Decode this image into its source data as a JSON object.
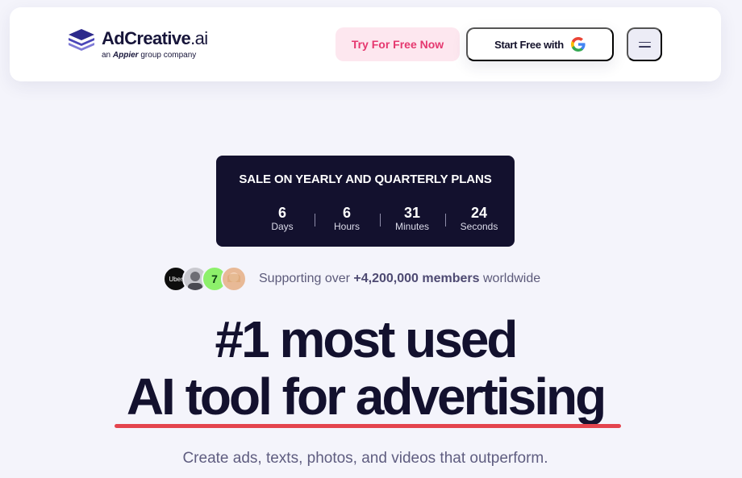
{
  "nav": {
    "logo_word": "AdCreative",
    "logo_word_suffix": ".ai",
    "logo_sub_prefix": "an",
    "logo_sub_brand": "Appier",
    "logo_sub_suffix": "group company",
    "try_button": "Try For Free Now",
    "google_button": "Start Free with",
    "google_icon": "google-g-icon",
    "menu_icon": "hamburger-menu-icon"
  },
  "sale": {
    "title": "SALE ON YEARLY AND QUARTERLY PLANS",
    "countdown": [
      {
        "value": "6",
        "label": "Days"
      },
      {
        "value": "6",
        "label": "Hours"
      },
      {
        "value": "31",
        "label": "Minutes"
      },
      {
        "value": "24",
        "label": "Seconds"
      }
    ]
  },
  "social_proof": {
    "avatars": [
      "Uber",
      "person-portrait",
      "7",
      "person-portrait"
    ],
    "text_prefix": "Supporting over",
    "count": "+4,200,000 members",
    "text_suffix": "worldwide"
  },
  "hero": {
    "line1": "#1 most used",
    "line2": "AI tool for advertising",
    "underline_color": "#e4444e",
    "subtitle": "Create ads, texts, photos, and videos that outperform."
  },
  "colors": {
    "background": "#f4f4fb",
    "dark": "#13112e",
    "accent_pink": "#e5386f"
  }
}
